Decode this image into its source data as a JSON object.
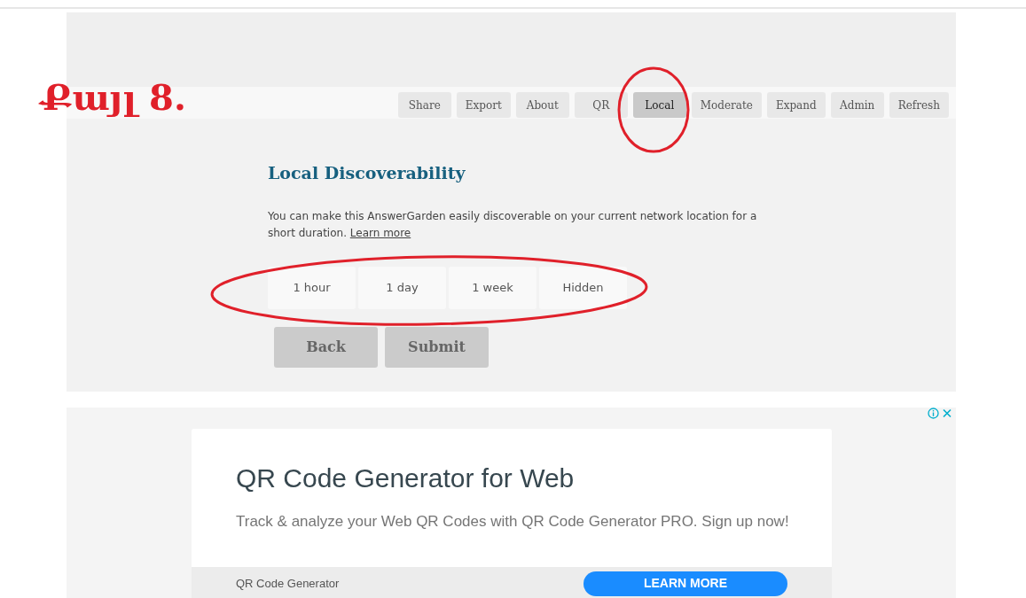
{
  "step_label": "Քայլ 8.",
  "toolbar": [
    {
      "label": "Share",
      "selected": false
    },
    {
      "label": "Export",
      "selected": false
    },
    {
      "label": "About",
      "selected": false
    },
    {
      "label": "QR",
      "selected": false
    },
    {
      "label": "Local",
      "selected": true
    },
    {
      "label": "Moderate",
      "selected": false
    },
    {
      "label": "Expand",
      "selected": false
    },
    {
      "label": "Admin",
      "selected": false
    },
    {
      "label": "Refresh",
      "selected": false
    }
  ],
  "panel": {
    "title": "Local Discoverability",
    "description": "You can make this AnswerGarden easily discoverable on your current network location for a short duration.",
    "learn_more_link": "Learn more",
    "durations": [
      "1 hour",
      "1 day",
      "1 week",
      "Hidden"
    ],
    "buttons": [
      "Back",
      "Submit"
    ]
  },
  "ad": {
    "title": "QR Code Generator for Web",
    "text": "Track & analyze your Web QR Codes with QR Code Generator PRO. Sign up now!",
    "advertiser": "QR Code Generator",
    "cta": "LEARN MORE"
  }
}
